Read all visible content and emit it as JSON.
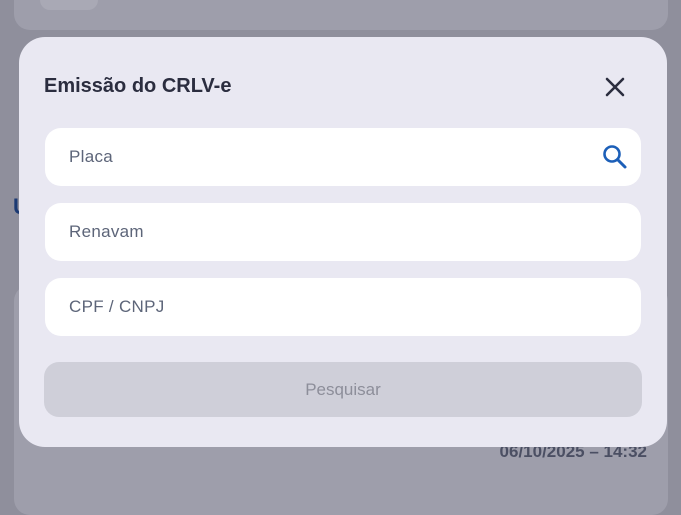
{
  "background": {
    "heading_fragment": "U",
    "timestamp": "06/10/2025 – 14:32"
  },
  "modal": {
    "title": "Emissão do CRLV-e",
    "close_icon": "close-icon",
    "fields": {
      "placa": {
        "placeholder": "Placa",
        "value": ""
      },
      "renavam": {
        "placeholder": "Renavam",
        "value": ""
      },
      "cpf_cnpj": {
        "placeholder": "CPF / CNPJ",
        "value": ""
      }
    },
    "search_icon": "search-icon",
    "submit_label": "Pesquisar"
  },
  "colors": {
    "accent": "#1c5fb8",
    "overlay": "#8f8f9c",
    "modal_bg": "#e9e8f2",
    "disabled_button": "#cfcfd9"
  }
}
